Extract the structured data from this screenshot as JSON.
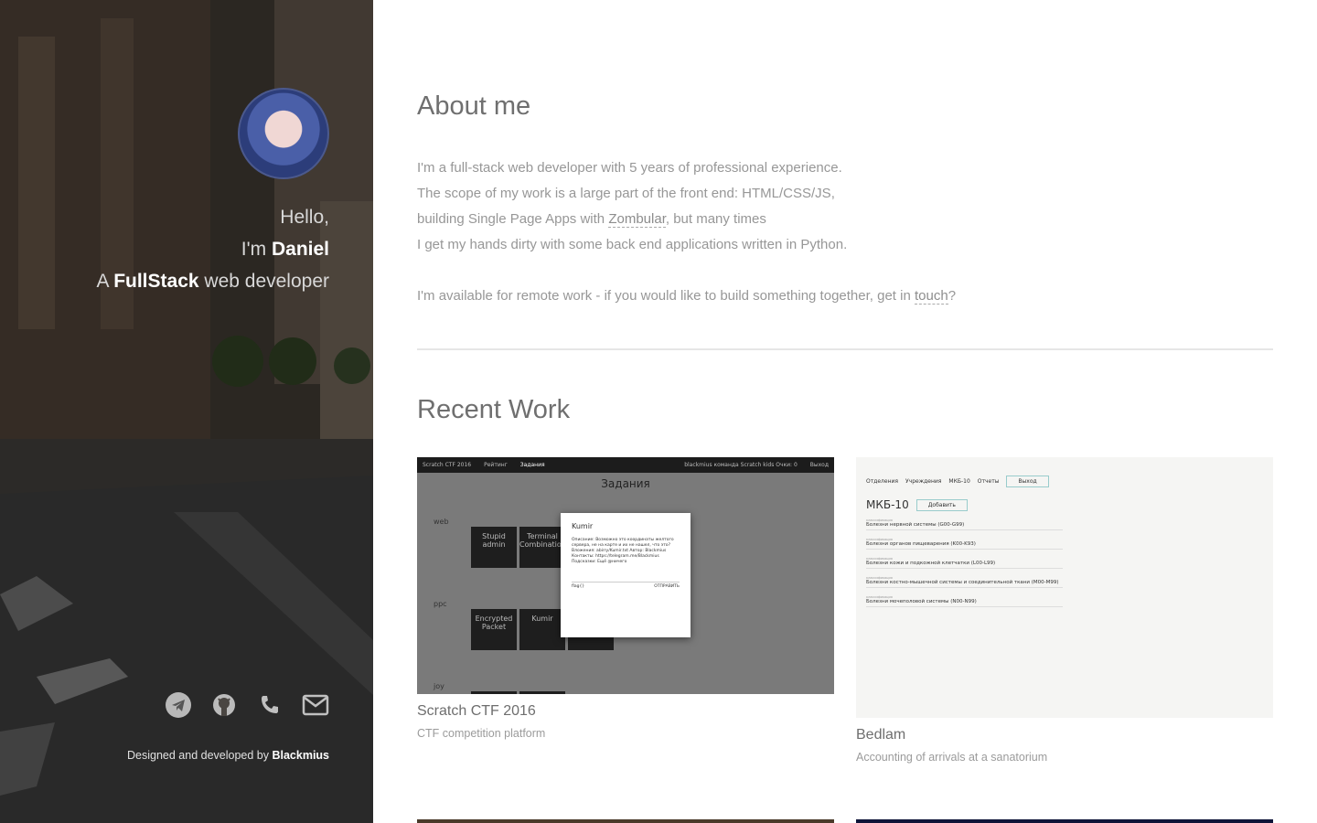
{
  "sidebar": {
    "greeting_line1": "Hello,",
    "greeting_line2_prefix": "I'm",
    "greeting_name": "Daniel",
    "greeting_line3_prefix": "A",
    "greeting_role_strong": "FullStack",
    "greeting_role_rest": "web developer",
    "social_icons": [
      "telegram-icon",
      "github-icon",
      "phone-icon",
      "mail-icon"
    ],
    "credits_prefix": "Designed and developed by",
    "credits_name": "Blackmius"
  },
  "about": {
    "title": "About me",
    "line1": "I'm a full-stack web developer with 5 years of professional experience.",
    "line2": "The scope of my work is a large part of the front end: HTML/CSS/JS,",
    "line3_prefix": "building Single Page Apps with",
    "line3_link": "Zombular",
    "line3_suffix": ", but many times",
    "line4": "I get my hands dirty with some back end applications written in Python.",
    "line5_prefix": "I'm available for remote work - if you would like to build something together, get in",
    "line5_link": "touch",
    "line5_suffix": "?"
  },
  "work": {
    "title": "Recent Work",
    "items": [
      {
        "name": "Scratch CTF 2016",
        "description": "CTF competition platform",
        "preview": {
          "bar_left": "Scratch CTF 2016",
          "bar_tab1": "Рейтинг",
          "bar_tab2": "Задания",
          "bar_right": "blackmius команда Scratch kids Очки: 0",
          "bar_logout": "Выход",
          "heading": "Задания",
          "cat_web": "web",
          "cat_ppc": "ppc",
          "cat_joy": "joy",
          "tile1": "Stupid admin",
          "tile2": "Terminal Combination",
          "tile3": "Encrypted Packet",
          "tile4": "Kumir",
          "modal_title": "Kumir",
          "modal_body": "Описание: Возможно это координаты желтого сервера, не на карте и их не нашел, что это? Вложения: abirry/Kumir.txt Автор: Blackmius Контакты: https://telegram.me/Blackmius Подсказки: Ещё @ничего",
          "modal_input": "flag{}",
          "modal_submit": "ОТПРАВИТЬ"
        }
      },
      {
        "name": "Bedlam",
        "description": "Accounting of arrivals at a sanatorium",
        "preview": {
          "nav1": "Отделения",
          "nav2": "Учреждения",
          "nav3": "МКБ-10",
          "nav4": "Отчеты",
          "nav_btn": "Выход",
          "heading": "МКБ-10",
          "add_btn": "Добавить",
          "row_caption": "классификация",
          "rows": [
            "Болезни нервной системы (G00-G99)",
            "Болезни органов пищеварения (K00-K93)",
            "Болезни кожи и подкожной клетчатки (L00-L99)",
            "Болезни костно-мышечной системы и соединительной ткани (M00-M99)",
            "Болезни мочеполовой системы (N00-N99)"
          ]
        }
      }
    ]
  }
}
